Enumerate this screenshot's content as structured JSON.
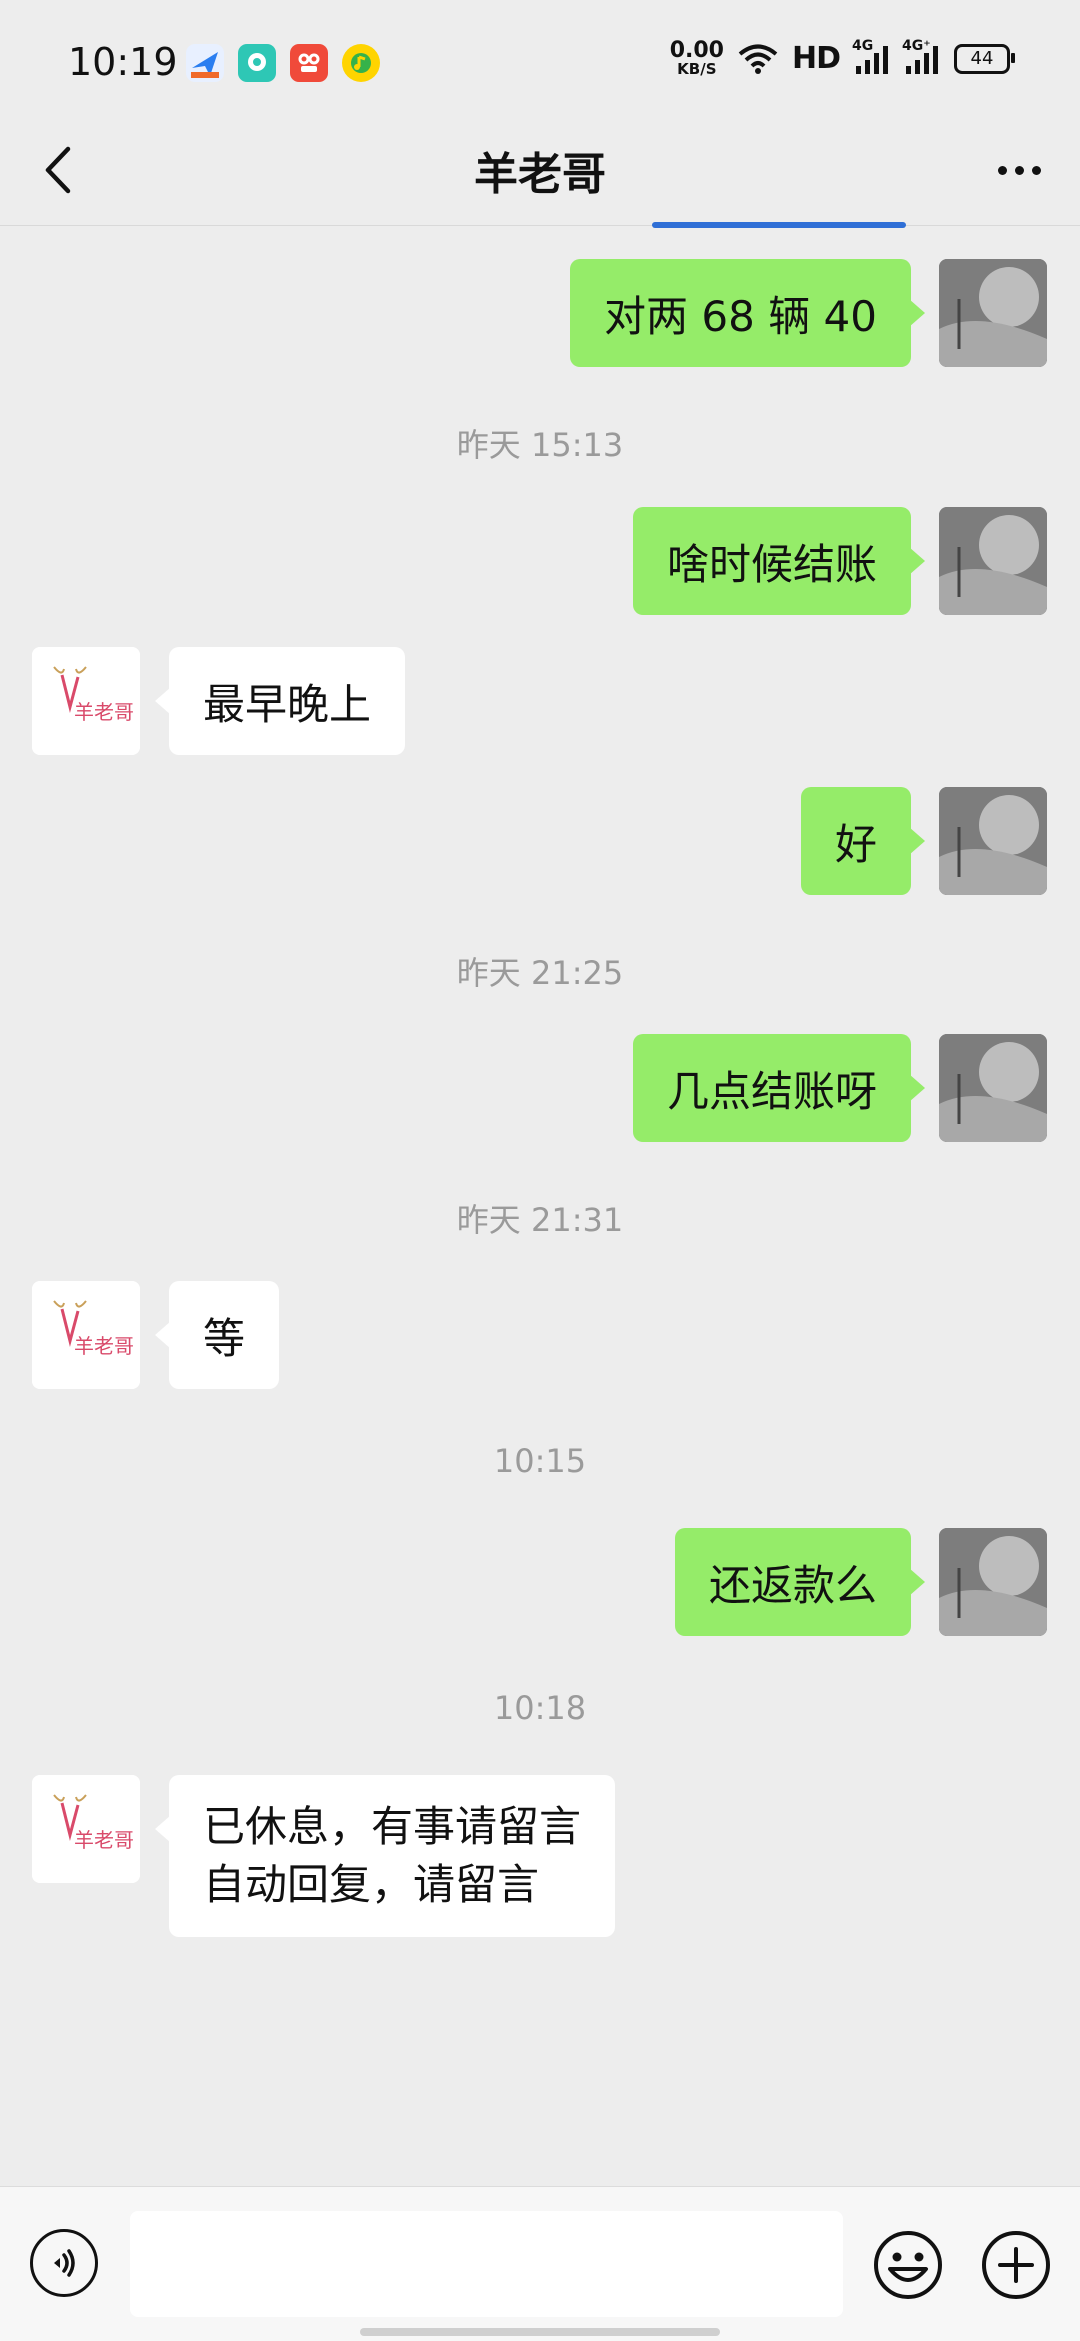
{
  "status_bar": {
    "time": "10:19",
    "net_speed_value": "0.00",
    "net_speed_unit": "KB/S",
    "network_type": "HD",
    "signal1_label": "4G",
    "signal2_label": "4G⁺",
    "battery": "44",
    "app_icons": [
      "maps-icon",
      "chat-app-icon",
      "shopping-app-icon",
      "music-app-icon"
    ]
  },
  "header": {
    "title": "羊老哥",
    "back_icon": "chevron-left-icon",
    "more_icon": "more-dots-icon"
  },
  "contact_avatar_text": "羊老哥",
  "messages": [
    {
      "type": "sent",
      "text": "对两 68 辆 40"
    },
    {
      "type": "time",
      "text": "昨天 15:13"
    },
    {
      "type": "sent",
      "text": "啥时候结账"
    },
    {
      "type": "received",
      "text": "最早晚上"
    },
    {
      "type": "sent",
      "text": "好"
    },
    {
      "type": "time",
      "text": "昨天 21:25"
    },
    {
      "type": "sent",
      "text": "几点结账呀"
    },
    {
      "type": "time",
      "text": "昨天 21:31"
    },
    {
      "type": "received",
      "text": "等"
    },
    {
      "type": "time",
      "text": "10:15"
    },
    {
      "type": "sent",
      "text": "还返款么"
    },
    {
      "type": "time",
      "text": "10:18"
    },
    {
      "type": "received",
      "lines": [
        "已休息，有事请留言",
        "自动回复，请留言"
      ]
    }
  ],
  "input_bar": {
    "voice_icon": "voice-icon",
    "input_value": "",
    "emoji_icon": "emoji-icon",
    "plus_icon": "plus-icon"
  },
  "colors": {
    "sent_bubble": "#95ec69",
    "received_bubble": "#ffffff",
    "background": "#ededed"
  }
}
